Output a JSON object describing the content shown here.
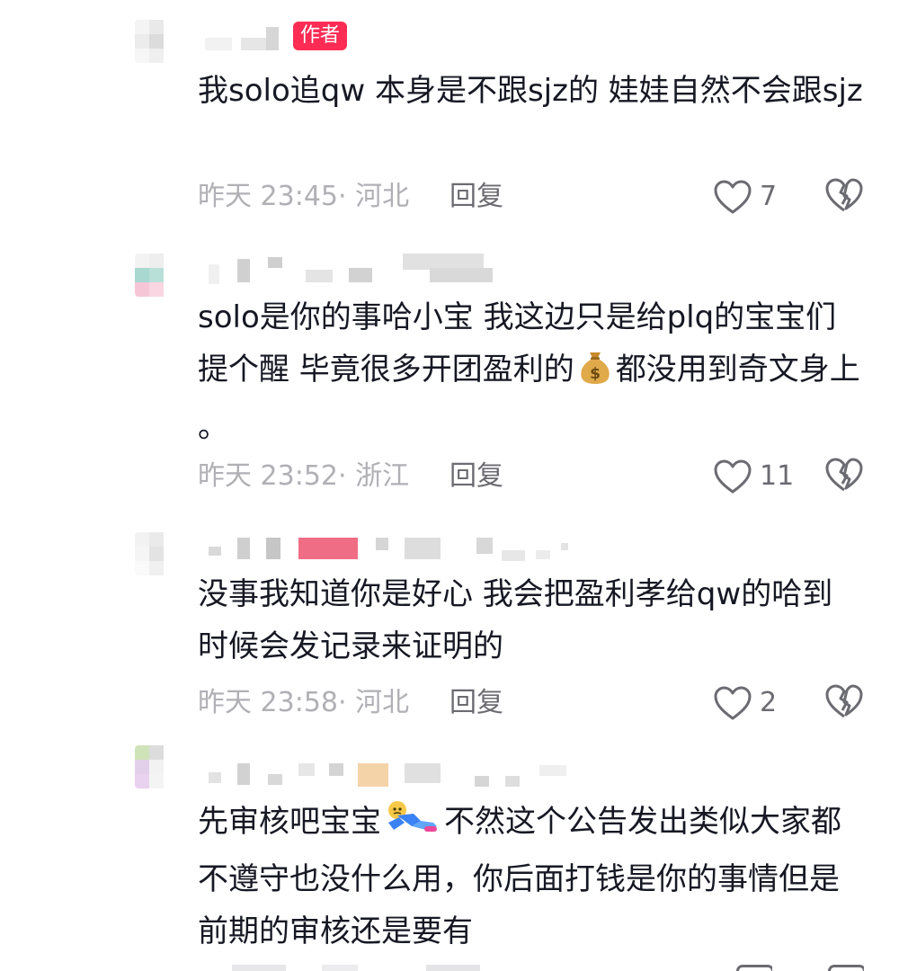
{
  "author_badge": "作者",
  "comments": [
    {
      "text": "我solo追qw 本身是不跟sjz的 娃娃自然不会跟sjz",
      "meta": "昨天 23:45· 河北",
      "reply_label": "回复",
      "likes": "7",
      "is_author": true
    },
    {
      "text_parts": [
        "solo是你的事哈小宝 我这边只是给plq的宝宝们提个醒 毕竟很多开团盈利的",
        "都没用到奇文身上 。"
      ],
      "inline_icon": "money-bag-emoji",
      "meta": "昨天 23:52· 浙江",
      "reply_label": "回复",
      "likes": "11"
    },
    {
      "text": "没事我知道你是好心 我会把盈利孝给qw的哈到时候会发记录来证明的",
      "meta": "昨天 23:58· 河北",
      "reply_label": "回复",
      "likes": "2"
    },
    {
      "text_parts": [
        "先审核吧宝宝",
        "不然这个公告发出类似大家都不遵守也没什么用，你后面打钱是你的事情但是前期的审核还是要有"
      ],
      "inline_icon": "lying-down-emoji"
    }
  ],
  "icons": {
    "like": "heart-outline-icon",
    "dislike": "broken-heart-icon"
  },
  "colors": {
    "badge": "#fe2c55",
    "meta_text": "#b0b0b5",
    "action_text": "#6b6b72",
    "body_text": "#161823"
  }
}
